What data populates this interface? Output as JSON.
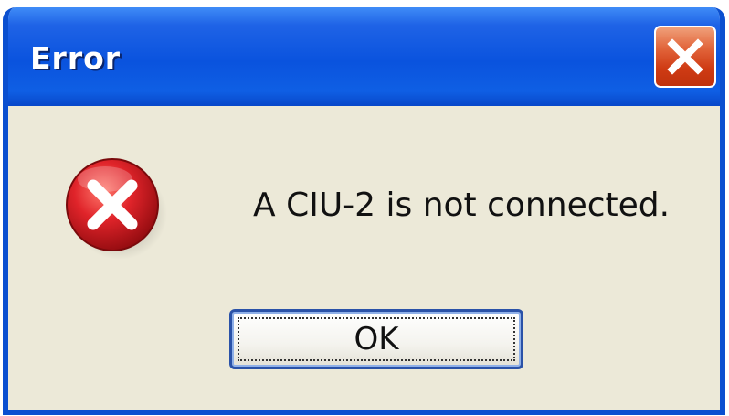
{
  "window": {
    "title": "Error"
  },
  "dialog": {
    "message": "A CIU-2 is not connected.",
    "icon": "error-icon",
    "ok_label": "OK"
  },
  "colors": {
    "titlebar": "#0a53de",
    "body": "#ece9d8",
    "close_button": "#d9471f",
    "error_icon": "#c8141b"
  }
}
